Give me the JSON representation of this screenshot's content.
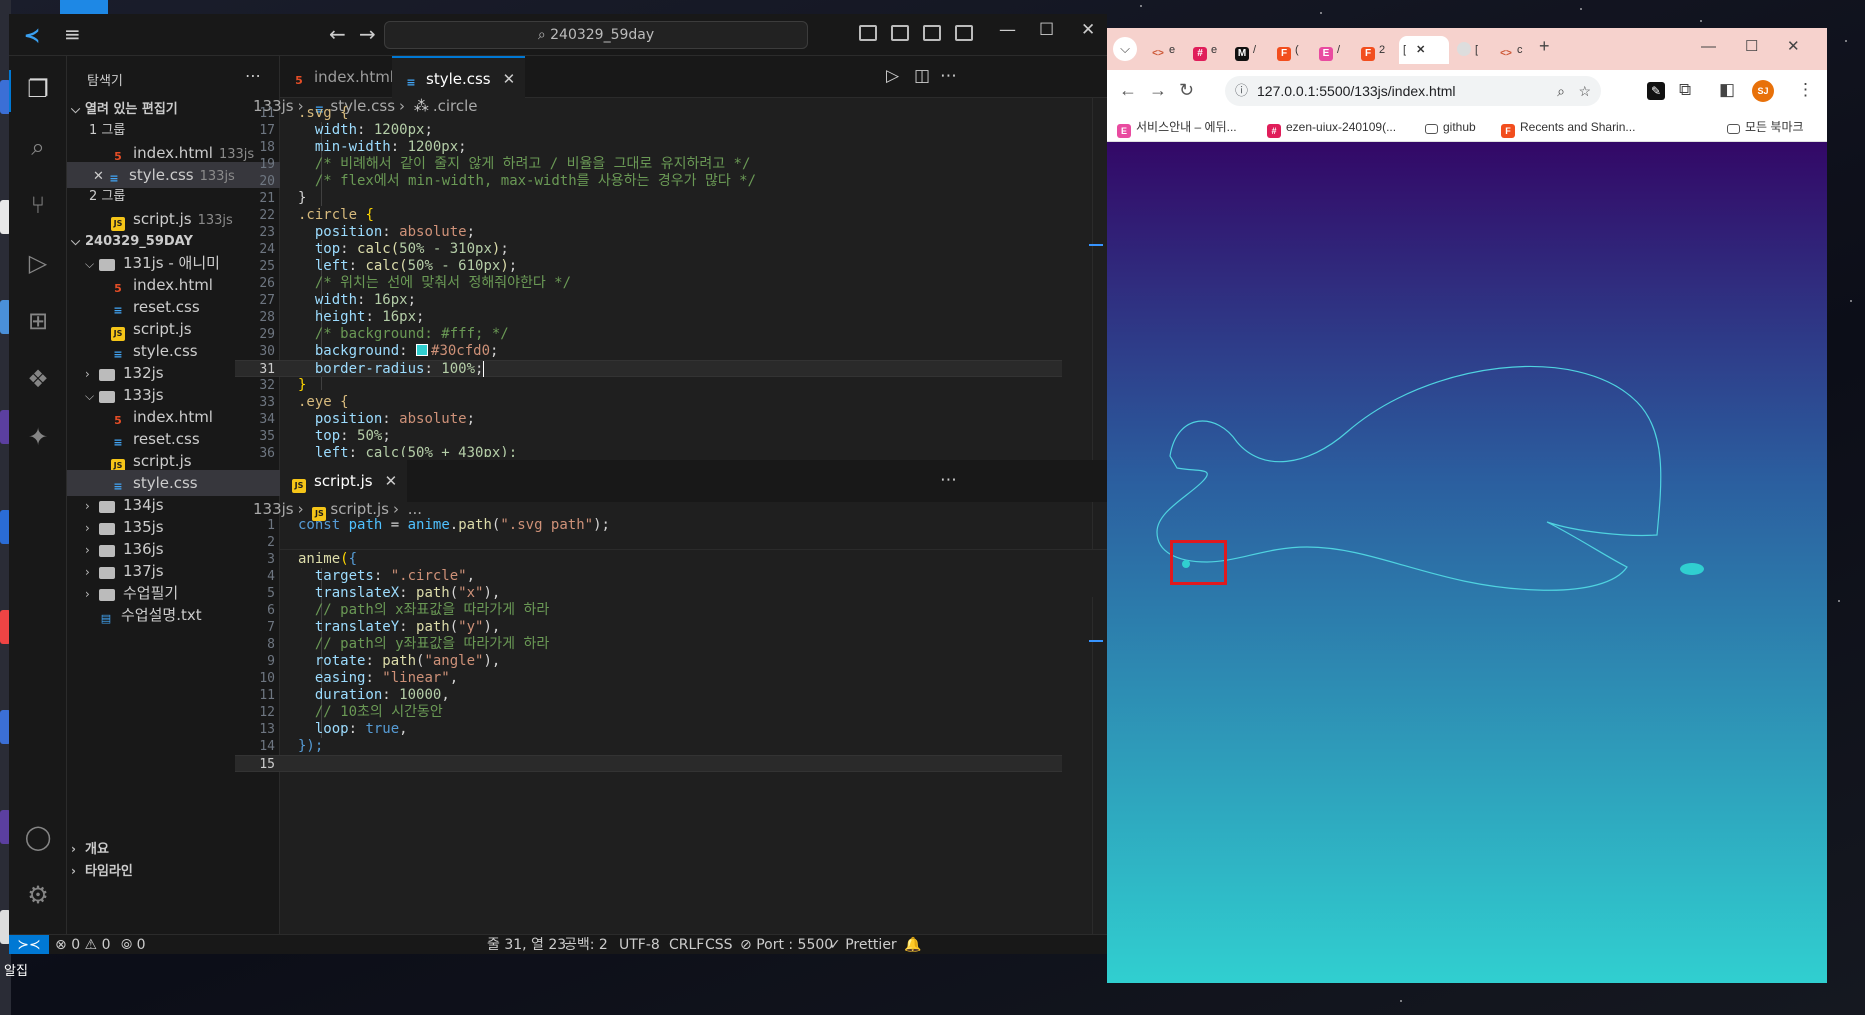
{
  "desktop": {
    "bottom_label": "알집"
  },
  "vscode": {
    "search_text": "240329_59day",
    "explorer": {
      "title": "탐색기",
      "open_editors_section": "열려 있는 편집기",
      "group1": "1 그룹",
      "group2": "2 그룹",
      "open_files": [
        {
          "name": "index.html",
          "desc": "133js"
        },
        {
          "name": "style.css",
          "desc": "133js"
        },
        {
          "name": "script.js",
          "desc": "133js"
        }
      ],
      "workspace": "240329_59DAY",
      "tree": [
        {
          "name": "131js - 애니미"
        },
        {
          "name": "index.html"
        },
        {
          "name": "reset.css"
        },
        {
          "name": "script.js"
        },
        {
          "name": "style.css"
        },
        {
          "name": "132js"
        },
        {
          "name": "133js"
        },
        {
          "name": "index.html"
        },
        {
          "name": "reset.css"
        },
        {
          "name": "script.js"
        },
        {
          "name": "style.css"
        },
        {
          "name": "134js"
        },
        {
          "name": "135js"
        },
        {
          "name": "136js"
        },
        {
          "name": "137js"
        },
        {
          "name": "수업필기"
        },
        {
          "name": "수업설명.txt"
        }
      ],
      "outline": "개요",
      "timeline": "타임라인"
    },
    "tabs": {
      "tab1": "index.html",
      "tab2": "style.css",
      "pane2_tab": "script.js"
    },
    "breadcrumb1": {
      "folder": "133js",
      "file": "style.css",
      "symbol": ".circle"
    },
    "breadcrumb2": {
      "folder": "133js",
      "file": "script.js",
      "symbol": "..."
    },
    "css_lines": [
      "11",
      "17",
      "18",
      "19",
      "20",
      "21",
      "22",
      "23",
      "24",
      "25",
      "26",
      "27",
      "28",
      "29",
      "30",
      "31",
      "32",
      "33",
      "34",
      "35",
      "36"
    ],
    "css_code": {
      "l11": ".svg {",
      "l17a": "width",
      "l17b": "1200px",
      "l18a": "min-width",
      "l18b": "1200px",
      "l19": "/* 비례해서 같이 줄지 않게 하려고 / 비율을 그대로 유지하려고 */",
      "l20": "/* flex에서 min-width, max-width를 사용하는 경우가 많다 */",
      "l21": "}",
      "l22": ".circle",
      "l23a": "position",
      "l23b": "absolute",
      "l24a": "top",
      "l24b": "calc(",
      "l24c": "50% - 310px",
      "l25a": "left",
      "l25b": "calc(",
      "l25c": "50% - 610px",
      "l26": "/* 위치는 선에 맞춰서 정해줘야한다 */",
      "l27a": "width",
      "l27b": "16px",
      "l28a": "height",
      "l28b": "16px",
      "l29": "/* background: #fff; */",
      "l30a": "background",
      "l30b": "#30cfd0",
      "l31a": "border-radius",
      "l31b": "100%",
      "l32": "}",
      "l33": ".eye {",
      "l34a": "position",
      "l34b": "absolute",
      "l35a": "top",
      "l35b": "50%",
      "l36a": "left",
      "l36b": "calc(50% + 430px);"
    },
    "js_lines": [
      "1",
      "2",
      "3",
      "4",
      "5",
      "6",
      "7",
      "8",
      "9",
      "10",
      "11",
      "12",
      "13",
      "14",
      "15"
    ],
    "js_code": {
      "l1a": "const",
      "l1b": "path",
      "l1c": "anime",
      "l1d": "path",
      "l1e": "\".svg path\"",
      "l3a": "anime",
      "l4a": "targets",
      "l4b": "\".circle\"",
      "l5a": "translateX",
      "l5b": "path",
      "l5c": "\"x\"",
      "l6": "// path의 x좌표값을 따라가게 하라",
      "l7a": "translateY",
      "l7b": "path",
      "l7c": "\"y\"",
      "l8": "// path의 y좌표값을 따라가게 하라",
      "l9a": "rotate",
      "l9b": "path",
      "l9c": "\"angle\"",
      "l10a": "easing",
      "l10b": "\"linear\"",
      "l11a": "duration",
      "l11b": "10000",
      "l12": "// 10초의 시간동안",
      "l13a": "loop",
      "l13b": "true",
      "l14": "});"
    },
    "status": {
      "errors": "0",
      "warnings": "0",
      "ports": "0",
      "position": "줄 31, 열 23",
      "spaces": "공백: 2",
      "encoding": "UTF-8",
      "eol": "CRLF",
      "language": "CSS",
      "port": "Port : 5500",
      "formatter": "Prettier"
    }
  },
  "browser": {
    "url": "127.0.0.1:5500/133js/index.html",
    "tabs": [
      {
        "label": "e",
        "icon": "code"
      },
      {
        "label": "e",
        "icon": "slack"
      },
      {
        "label": "/",
        "icon": "M"
      },
      {
        "label": "(",
        "icon": "figma"
      },
      {
        "label": "/",
        "icon": "E"
      },
      {
        "label": "2",
        "icon": "figma"
      },
      {
        "label": "[",
        "icon": "active"
      },
      {
        "label": "[",
        "icon": "blank"
      },
      {
        "label": "c",
        "icon": "code"
      }
    ],
    "bookmarks": [
      {
        "label": "서비스안내 – 에뒤..."
      },
      {
        "label": "ezen-uiux-240109(..."
      },
      {
        "label": "github"
      },
      {
        "label": "Recents and Sharin..."
      },
      {
        "label": "모든 북마크"
      }
    ],
    "avatar": "SJ",
    "accent": "#30cfd0"
  }
}
